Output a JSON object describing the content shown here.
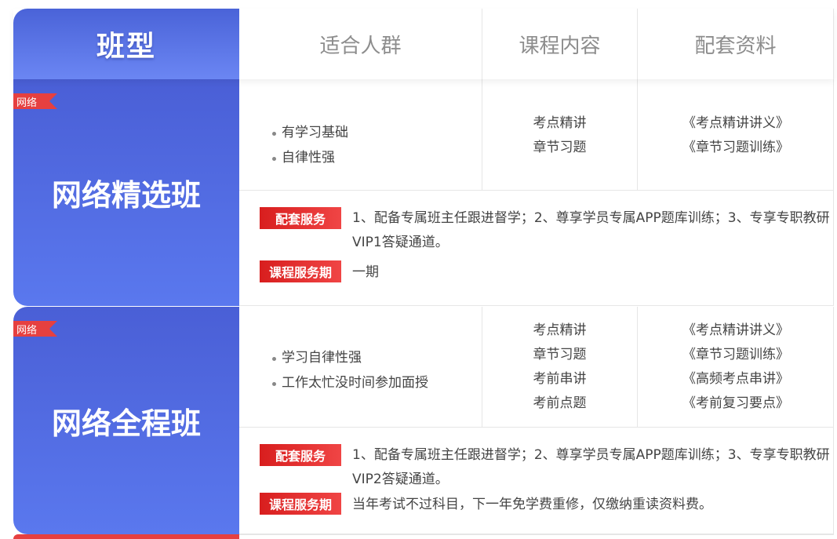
{
  "header": {
    "type_label": "班型",
    "col_audience": "适合人群",
    "col_content": "课程内容",
    "col_materials": "配套资料"
  },
  "colors": {
    "brand_blue": "#4a5fd6",
    "label_red": "#e02a2a"
  },
  "rows": [
    {
      "tag": "网络",
      "name": "网络精选班",
      "audience": [
        "有学习基础",
        "自律性强"
      ],
      "content": [
        "考点精讲",
        "章节习题"
      ],
      "materials": [
        "《考点精讲讲义》",
        "《章节习题训练》"
      ],
      "service_label": "配套服务",
      "service_text": "1、配备专属班主任跟进督学；2、尊享学员专属APP题库训练；3、专享专职教研VIP1答疑通道。",
      "period_label": "课程服务期",
      "period_text": "一期"
    },
    {
      "tag": "网络",
      "name": "网络全程班",
      "audience": [
        "学习自律性强",
        "工作太忙没时间参加面授"
      ],
      "content": [
        "考点精讲",
        "章节习题",
        "考前串讲",
        "考前点题"
      ],
      "materials": [
        "《考点精讲讲义》",
        "《章节习题训练》",
        "《高频考点串讲》",
        "《考前复习要点》"
      ],
      "service_label": "配套服务",
      "service_text": "1、配备专属班主任跟进督学；2、尊享学员专属APP题库训练；3、专享专职教研VIP2答疑通道。",
      "period_label": "课程服务期",
      "period_text": "当年考试不过科目，下一年免学费重修，仅缴纳重读资料费。"
    }
  ]
}
